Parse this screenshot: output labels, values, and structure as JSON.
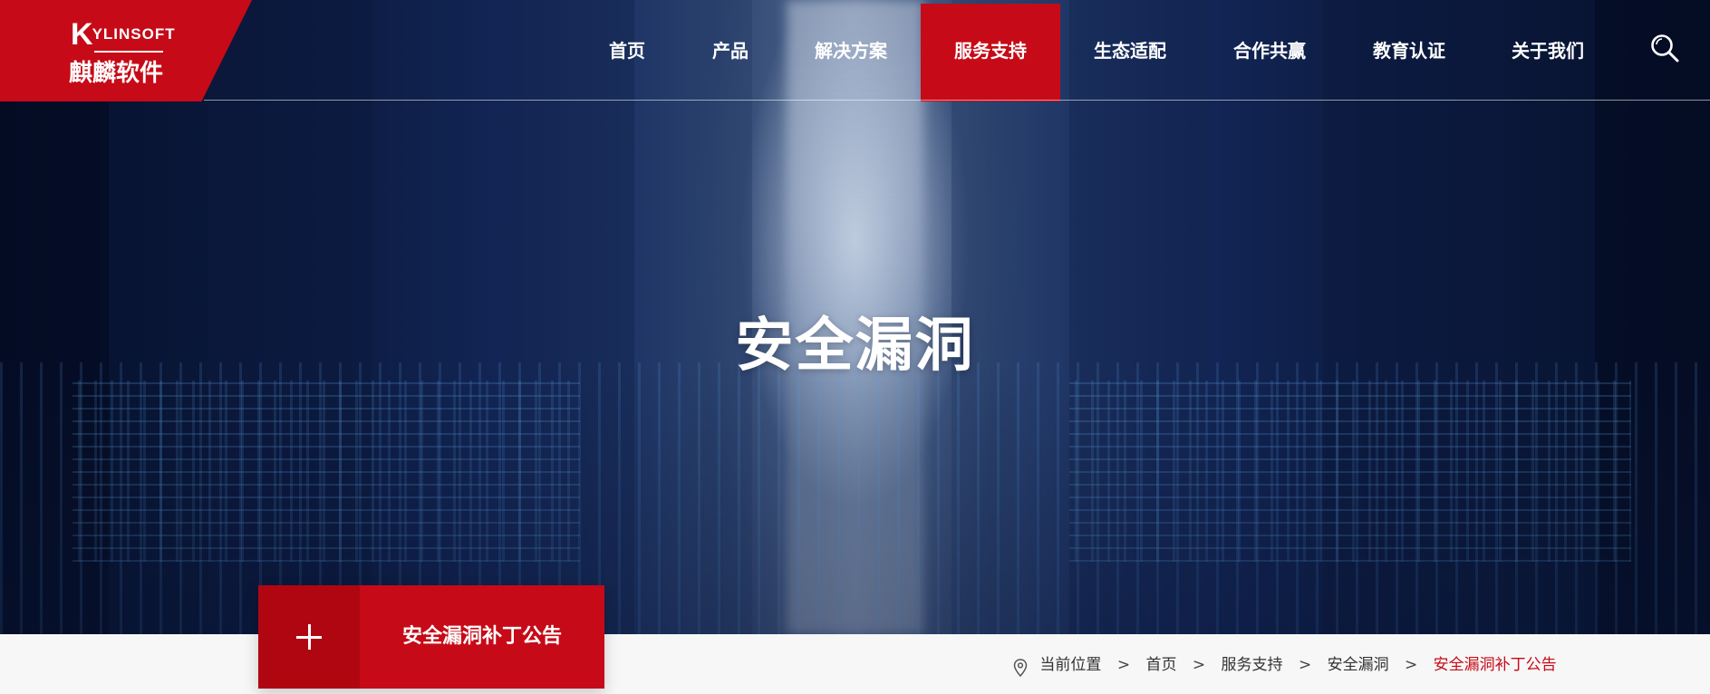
{
  "logo": {
    "brand_en_initial": "K",
    "brand_en_rest": "YLINSOFT",
    "brand_cn": "麒麟软件"
  },
  "nav": {
    "items": [
      {
        "label": "首页",
        "active": false
      },
      {
        "label": "产品",
        "active": false
      },
      {
        "label": "解决方案",
        "active": false
      },
      {
        "label": "服务支持",
        "active": true
      },
      {
        "label": "生态适配",
        "active": false
      },
      {
        "label": "合作共赢",
        "active": false
      },
      {
        "label": "教育认证",
        "active": false
      },
      {
        "label": "关于我们",
        "active": false
      }
    ],
    "search_icon": "search-icon"
  },
  "hero": {
    "title": "安全漏洞"
  },
  "category": {
    "label": "安全漏洞补丁公告",
    "icon": "plus-icon"
  },
  "breadcrumb": {
    "prefix": "当前位置",
    "separator": ">",
    "items": [
      "首页",
      "服务支持",
      "安全漏洞"
    ],
    "current": "安全漏洞补丁公告"
  },
  "colors": {
    "brand_red": "#c70a17",
    "dark_red": "#b00612",
    "hero_dark": "#0b1a3f",
    "bar_bg": "#f7f7f7"
  }
}
